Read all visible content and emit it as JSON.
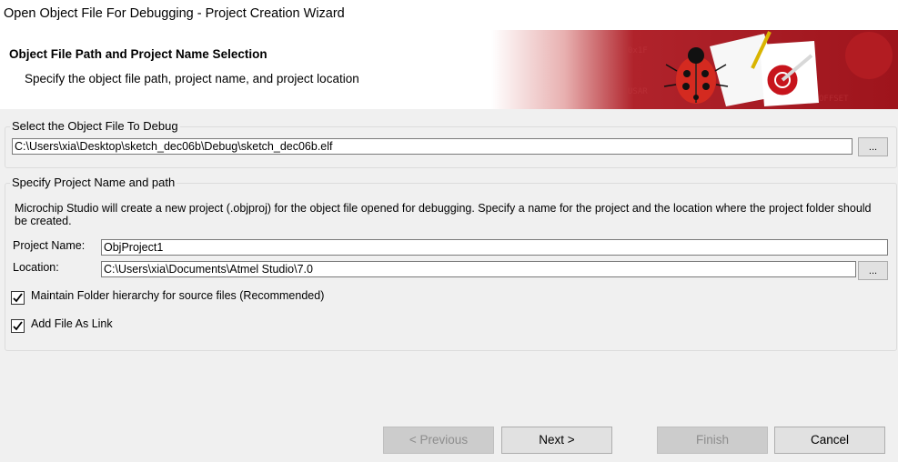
{
  "window": {
    "title": "Open Object File For Debugging  -  Project Creation Wizard"
  },
  "banner": {
    "heading": "Object File Path and Project Name Selection",
    "subheading": "Specify the object file path, project name, and project location"
  },
  "object_file": {
    "group_label": "Select the Object File To Debug",
    "path": "C:\\Users\\xia\\Desktop\\sketch_dec06b\\Debug\\sketch_dec06b.elf",
    "browse_label": "..."
  },
  "project": {
    "group_label": "Specify Project Name and path",
    "description": "Microchip Studio will create a new project (.objproj) for the object file opened for debugging. Specify a name for the project and the location where the project folder should be created.",
    "name_label": "Project Name:",
    "name_value": "ObjProject1",
    "location_label": "Location:",
    "location_value": "C:\\Users\\xia\\Documents\\Atmel Studio\\7.0",
    "browse_label": "...",
    "maintain_hierarchy_label": "Maintain Folder hierarchy for source files (Recommended)",
    "maintain_hierarchy_checked": true,
    "add_as_link_label": "Add File As Link",
    "add_as_link_checked": true
  },
  "buttons": {
    "previous": "< Previous",
    "next": "Next >",
    "finish": "Finish",
    "cancel": "Cancel"
  }
}
